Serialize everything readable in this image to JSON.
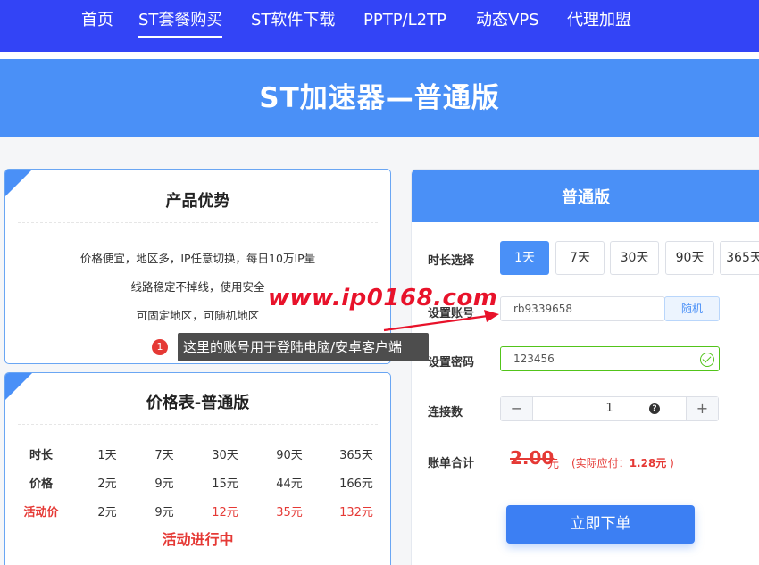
{
  "nav": {
    "items": [
      {
        "label": "首页"
      },
      {
        "label": "ST套餐购买"
      },
      {
        "label": "ST软件下载"
      },
      {
        "label": "PPTP/L2TP"
      },
      {
        "label": "动态VPS"
      },
      {
        "label": "代理加盟"
      }
    ],
    "active": 1
  },
  "banner": {
    "title": "ST加速器—普通版"
  },
  "advantages": {
    "title": "产品优势",
    "lines": [
      "价格便宜，地区多，IP任意切换，每日10万IP量",
      "线路稳定不掉线，使用安全",
      "可固定地区，可随机地区"
    ]
  },
  "tooltip": {
    "badge": "1",
    "text": "这里的账号用于登陆电脑/安卓客户端"
  },
  "price_table": {
    "title": "价格表-普通版",
    "rows": [
      {
        "label": "时长",
        "cells": [
          "1天",
          "7天",
          "30天",
          "90天",
          "365天"
        ]
      },
      {
        "label": "价格",
        "cells": [
          "2元",
          "9元",
          "15元",
          "44元",
          "166元"
        ]
      },
      {
        "label": "活动价",
        "cells": [
          "2元",
          "9元",
          "12元",
          "35元",
          "132元"
        ]
      }
    ],
    "promo": "活动进行中"
  },
  "order": {
    "title": "普通版",
    "duration_label": "时长选择",
    "durations": [
      "1天",
      "7天",
      "30天",
      "90天",
      "365天"
    ],
    "account_label": "设置账号",
    "account_value": "rb9339658",
    "random_label": "随机",
    "password_label": "设置密码",
    "password_value": "123456",
    "connections_label": "连接数",
    "connections_value": "1",
    "minus": "−",
    "plus": "+",
    "help": "?",
    "total_label": "账单合计",
    "total_original": "2.00",
    "total_unit": "元",
    "actual_prefix": "(实际应付：",
    "actual_amount": "1.28元",
    "actual_suffix": " )",
    "submit_label": "立即下单"
  },
  "watermark": {
    "text": "www.ip0168.com"
  },
  "colors": {
    "nav": "#3344f6",
    "banner": "#4a90f7",
    "accent": "#4a90f7",
    "red": "#e53935",
    "success": "#52c41a"
  }
}
